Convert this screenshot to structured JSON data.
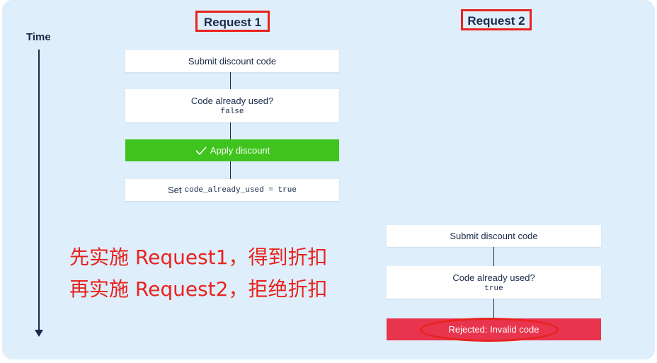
{
  "axis": {
    "label": "Time"
  },
  "request1": {
    "header": "Request 1",
    "steps": {
      "submit": "Submit discount code",
      "check_label": "Code already used?",
      "check_value": "false",
      "apply": "Apply discount",
      "set_prefix": "Set",
      "set_code": "code_already_used = true"
    }
  },
  "request2": {
    "header": "Request 2",
    "steps": {
      "submit": "Submit discount code",
      "check_label": "Code already used?",
      "check_value": "true",
      "rejected": "Rejected: Invalid code"
    }
  },
  "annotation": {
    "line1": "先实施 Request1，得到折扣",
    "line2": "再实施 Request2，拒绝折扣"
  },
  "colors": {
    "panel_bg": "#dfeefb",
    "success": "#3ec41c",
    "error": "#e8344c",
    "highlight": "#e8231e",
    "text_dark": "#1a2a4a"
  },
  "icons": {
    "apply": "check-icon"
  }
}
